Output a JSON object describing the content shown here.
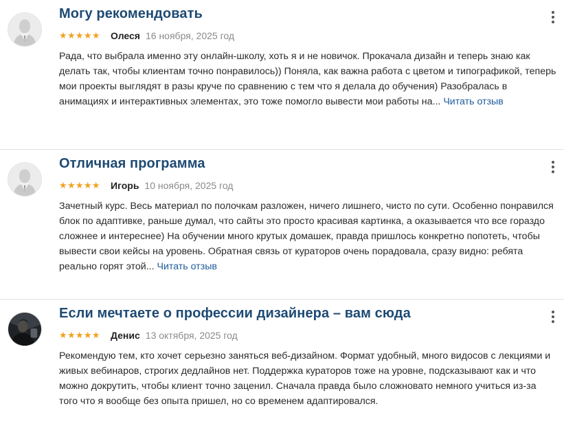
{
  "reviews": [
    {
      "title": "Могу рекомендовать",
      "stars": "★★★★★",
      "rating": 5,
      "author": "Олеся",
      "date": "16 ноября, 2025 год",
      "text": "Рада, что выбрала именно эту онлайн-школу, хоть я и не новичок. Прокачала дизайн и теперь знаю как делать так, чтобы клиентам точно понравилось)) Поняла, как важна работа с цветом и типографикой, теперь мои проекты выглядят в разы круче по сравнению с тем что я делала до обучения) Разобралась в анимациях и интерактивных элементах, это тоже помогло вывести мои работы на...",
      "more": "Читать отзыв",
      "avatar_icon": "default-user-avatar-icon",
      "menu_icon": "more-vertical-icon"
    },
    {
      "title": "Отличная программа",
      "stars": "★★★★★",
      "rating": 5,
      "author": "Игорь",
      "date": "10 ноября, 2025 год",
      "text": "Зачетный курс. Весь материал по полочкам разложен, ничего лишнего, чисто по сути. Особенно понравился блок по адаптивке, раньше думал, что сайты это просто красивая картинка, а оказывается что все гораздо сложнее и интереснее) На обучении много крутых домашек, правда пришлось конкретно попотеть, чтобы вывести свои кейсы на уровень. Обратная связь от кураторов очень порадовала, сразу видно: ребята реально горят этой...",
      "more": "Читать отзыв",
      "avatar_icon": "default-user-avatar-icon",
      "menu_icon": "more-vertical-icon"
    },
    {
      "title": "Если мечтаете о профессии дизайнера – вам сюда",
      "stars": "★★★★★",
      "rating": 5,
      "author": "Денис",
      "date": "13 октября, 2025 год",
      "text": "Рекомендую тем, кто хочет серьезно заняться веб-дизайном. Формат удобный, много видосов с лекциями и живых вебинаров, строгих дедлайнов нет. Поддержка кураторов тоже на уровне, подсказывают как и что можно докрутить, чтобы клиент точно заценил. Сначала правда было сложновато немного учиться из-за того что я вообще без опыта пришел, но со временем адаптировался.",
      "avatar_icon": "user-photo-avatar",
      "menu_icon": "more-vertical-icon"
    }
  ],
  "colors": {
    "title": "#1d4a73",
    "link": "#1d5b9a",
    "stars": "#f2a11f",
    "date": "#8a8a8a",
    "divider": "#e2e2e2"
  }
}
